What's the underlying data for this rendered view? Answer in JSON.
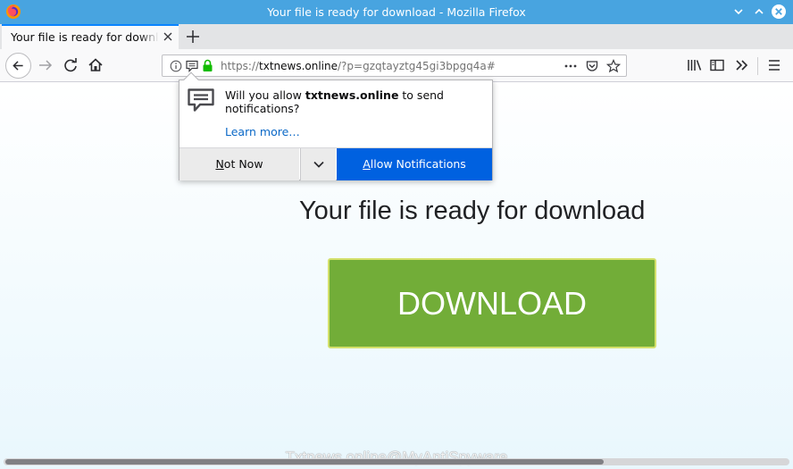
{
  "window": {
    "title": "Your file is ready for download - Mozilla Firefox"
  },
  "tab": {
    "title": "Your file is ready for download"
  },
  "urlbar": {
    "url_prefix": "https://",
    "url_host": "txtnews.online",
    "url_rest": "/?p=gzqtayztg45gi3bpgq4a#"
  },
  "notification_popup": {
    "message_prefix": "Will you allow ",
    "site": "txtnews.online",
    "message_suffix": " to send notifications?",
    "learn_more": "Learn more…",
    "not_now": "Not Now",
    "allow": "Allow Notifications"
  },
  "page": {
    "heading": "Your file is ready for download",
    "download_button": "DOWNLOAD",
    "watermark": "Txtnews.online@MyAntiSpyware"
  },
  "colors": {
    "titlebar": "#48a4e0",
    "download_button": "#72ad38",
    "allow_button": "#0061e0"
  },
  "icons": [
    "firefox-logo-icon",
    "minimize-icon",
    "maximize-icon",
    "close-window-icon",
    "close-tab-icon",
    "new-tab-icon",
    "back-icon",
    "forward-icon",
    "reload-icon",
    "home-icon",
    "info-icon",
    "notification-icon",
    "lock-icon",
    "page-actions-icon",
    "pocket-icon",
    "bookmark-star-icon",
    "library-icon",
    "sidebar-icon",
    "overflow-icon",
    "menu-icon",
    "speech-bubble-icon",
    "chevron-down-icon"
  ]
}
